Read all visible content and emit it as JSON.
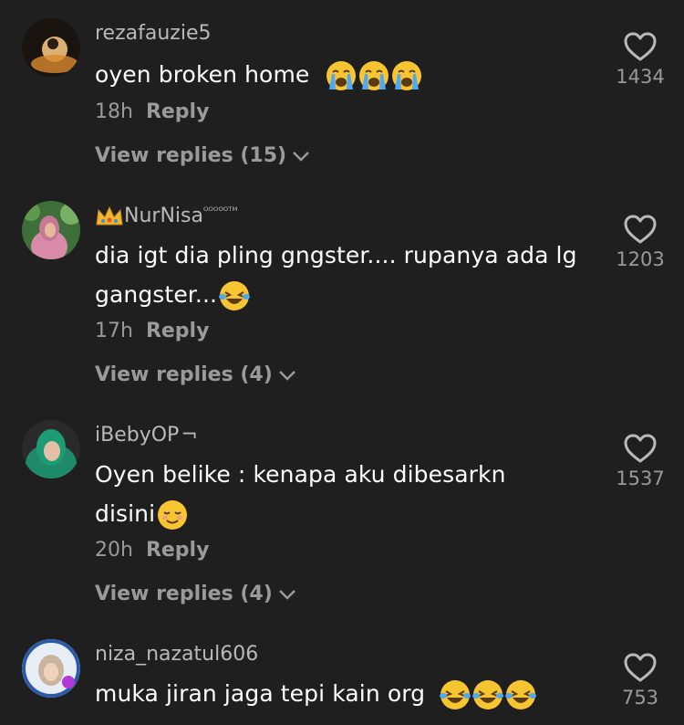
{
  "colors": {
    "background": "#1f1f1f",
    "username": "#b9b9b9",
    "secondary": "#9a9a9a",
    "text": "#ffffff",
    "emoji_yellow": "#f7c531"
  },
  "comments": [
    {
      "username": "rezafauzie5",
      "text": "oyen broken home",
      "emojis": [
        "crying-face-emoji",
        "crying-face-emoji",
        "crying-face-emoji"
      ],
      "time": "18h",
      "reply_label": "Reply",
      "view_replies": "View replies (15)",
      "likes": "1434"
    },
    {
      "username_prefix_icon": "crown-emoji",
      "username": "NurNisa",
      "username_suffix": "ᴼᴼᴼᴼᴼᵀᴹ",
      "text": "dia igt dia pling gngster.... rupanya ada lg gangster...",
      "emojis": [
        "tears-of-joy-emoji"
      ],
      "time": "17h",
      "reply_label": "Reply",
      "view_replies": "View replies (4)",
      "likes": "1203"
    },
    {
      "username": "iBebyOP",
      "username_suffix": "¬",
      "text": "Oyen belike : kenapa aku dibesarkn disini",
      "emojis": [
        "relieved-face-emoji"
      ],
      "time": "20h",
      "reply_label": "Reply",
      "view_replies": "View replies (4)",
      "likes": "1537"
    },
    {
      "username": "niza_nazatul606",
      "text": "muka jiran jaga tepi kain org",
      "emojis": [
        "tears-of-joy-emoji",
        "tears-of-joy-emoji",
        "tears-of-joy-emoji"
      ],
      "likes": "753"
    }
  ]
}
